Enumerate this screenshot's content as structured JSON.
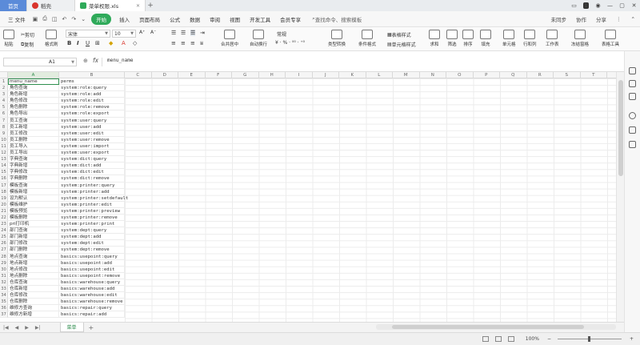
{
  "titlebar": {
    "tabs": [
      {
        "label": "首页",
        "color": "#5b8bd9"
      },
      {
        "label": "稻壳",
        "color": "#d9342b"
      },
      {
        "label": "菜单权限.xls",
        "color": "#2faa5a"
      }
    ],
    "win_badge": "1"
  },
  "menubar": {
    "file": "三 文件",
    "start": "开始",
    "items": [
      "插入",
      "页面布局",
      "公式",
      "数据",
      "审阅",
      "视图",
      "开发工具",
      "会员专享"
    ],
    "search": "查找命令、搜索模板",
    "right": [
      "未同步",
      "协作",
      "分享"
    ]
  },
  "ribbon": {
    "paste": "粘贴",
    "cut": "剪切",
    "copy": "复制",
    "format_painter": "格式刷",
    "font_name": "宋体",
    "font_size": "10",
    "merge": "合并居中",
    "wrap": "自动换行",
    "number_format": "常规",
    "type_convert": "类型转换",
    "cond_format": "条件格式",
    "table_style": "表格样式",
    "cell_style": "单元格样式",
    "sum": "求和",
    "filter": "筛选",
    "sort": "排序",
    "fill": "填充",
    "cell": "单元格",
    "rowcol": "行和列",
    "worksheet": "工作表",
    "freeze": "冻结窗格",
    "tools": "表格工具"
  },
  "formula": {
    "cell_ref": "A1",
    "fx": "fx",
    "value": "menu_name"
  },
  "columns": [
    "A",
    "B",
    "C",
    "D",
    "E",
    "F",
    "G",
    "H",
    "I",
    "J",
    "K",
    "L",
    "M",
    "N",
    "O",
    "P",
    "Q",
    "R",
    "S",
    "T",
    "U",
    "V"
  ],
  "rows": [
    {
      "n": "1",
      "a": "menu_name",
      "b": "perms"
    },
    {
      "n": "2",
      "a": "角色查询",
      "b": "system:role:query"
    },
    {
      "n": "3",
      "a": "角色新增",
      "b": "system:role:add"
    },
    {
      "n": "4",
      "a": "角色修改",
      "b": "system:role:edit"
    },
    {
      "n": "5",
      "a": "角色删除",
      "b": "system:role:remove"
    },
    {
      "n": "6",
      "a": "角色导出",
      "b": "system:role:export"
    },
    {
      "n": "7",
      "a": "员工查询",
      "b": "system:user:query"
    },
    {
      "n": "8",
      "a": "员工新增",
      "b": "system:user:add"
    },
    {
      "n": "9",
      "a": "员工修改",
      "b": "system:user:edit"
    },
    {
      "n": "10",
      "a": "员工删除",
      "b": "system:user:remove"
    },
    {
      "n": "11",
      "a": "员工导入",
      "b": "system:user:import"
    },
    {
      "n": "12",
      "a": "员工导出",
      "b": "system:user:export"
    },
    {
      "n": "13",
      "a": "字典查询",
      "b": "system:dict:query"
    },
    {
      "n": "14",
      "a": "字典新增",
      "b": "system:dict:add"
    },
    {
      "n": "15",
      "a": "字典修改",
      "b": "system:dict:edit"
    },
    {
      "n": "16",
      "a": "字典删除",
      "b": "system:dict:remove"
    },
    {
      "n": "17",
      "a": "模板查询",
      "b": "system:printer:query"
    },
    {
      "n": "18",
      "a": "模板新增",
      "b": "system:printer:add"
    },
    {
      "n": "19",
      "a": "设为默认",
      "b": "system:printer:setdefault"
    },
    {
      "n": "20",
      "a": "模板维护",
      "b": "system:printer:edit"
    },
    {
      "n": "21",
      "a": "模板预览",
      "b": "system:printer:preview"
    },
    {
      "n": "22",
      "a": "模板删除",
      "b": "system:printer:remove"
    },
    {
      "n": "23",
      "a": "pri打印机",
      "b": "system:printer:print"
    },
    {
      "n": "24",
      "a": "部门查询",
      "b": "system:dept:query"
    },
    {
      "n": "25",
      "a": "部门新增",
      "b": "system:dept:add"
    },
    {
      "n": "26",
      "a": "部门修改",
      "b": "system:dept:edit"
    },
    {
      "n": "27",
      "a": "部门删除",
      "b": "system:dept:remove"
    },
    {
      "n": "28",
      "a": "地点查询",
      "b": "basics:usepoint:query"
    },
    {
      "n": "29",
      "a": "地点新增",
      "b": "basics:usepoint:add"
    },
    {
      "n": "30",
      "a": "地点修改",
      "b": "basics:usepoint:edit"
    },
    {
      "n": "31",
      "a": "地点删除",
      "b": "basics:usepoint:remove"
    },
    {
      "n": "32",
      "a": "仓库查询",
      "b": "basics:warehouse:query"
    },
    {
      "n": "33",
      "a": "仓库新增",
      "b": "basics:warehouse:add"
    },
    {
      "n": "34",
      "a": "仓库修改",
      "b": "basics:warehouse:edit"
    },
    {
      "n": "35",
      "a": "仓库删除",
      "b": "basics:warehouse:remove"
    },
    {
      "n": "36",
      "a": "维修方查询",
      "b": "basics:repair:query"
    },
    {
      "n": "37",
      "a": "维修方新增",
      "b": "basics:repair:add"
    }
  ],
  "sheet": {
    "tab": "菜单"
  },
  "status": {
    "zoom": "100%"
  }
}
